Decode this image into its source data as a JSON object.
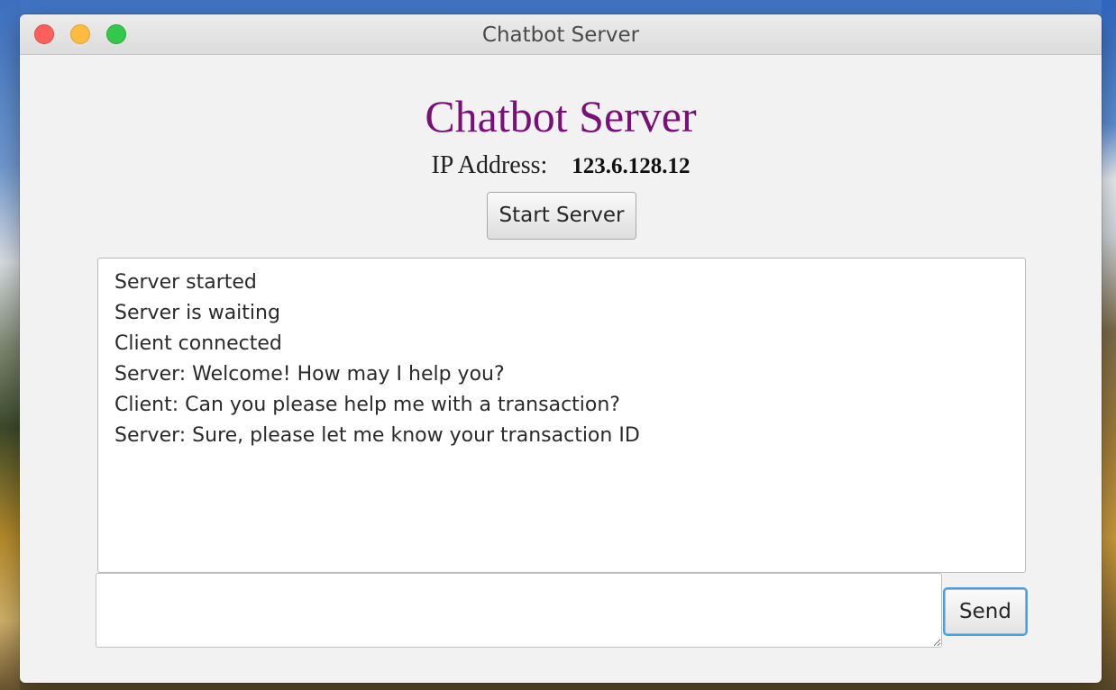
{
  "window": {
    "title": "Chatbot Server"
  },
  "header": {
    "heading": "Chatbot Server",
    "ip_label": "IP Address:",
    "ip_value": "123.6.128.12",
    "start_button_label": "Start Server"
  },
  "log": {
    "lines": [
      "Server started",
      "Server is waiting",
      "Client connected",
      "Server: Welcome! How may I help you?",
      "Client: Can you please help me with a transaction?",
      "Server: Sure, please let me know your transaction ID"
    ]
  },
  "composer": {
    "input_value": "",
    "send_label": "Send"
  },
  "colors": {
    "heading": "#7a0f7a",
    "window_background": "#f2f2f2",
    "focus_ring": "#3ea3e6",
    "close": "#fc605b",
    "minimize": "#fdbc40",
    "zoom": "#34c84a"
  },
  "icons": [
    "close-window-button",
    "minimize-window-button",
    "zoom-window-button"
  ]
}
